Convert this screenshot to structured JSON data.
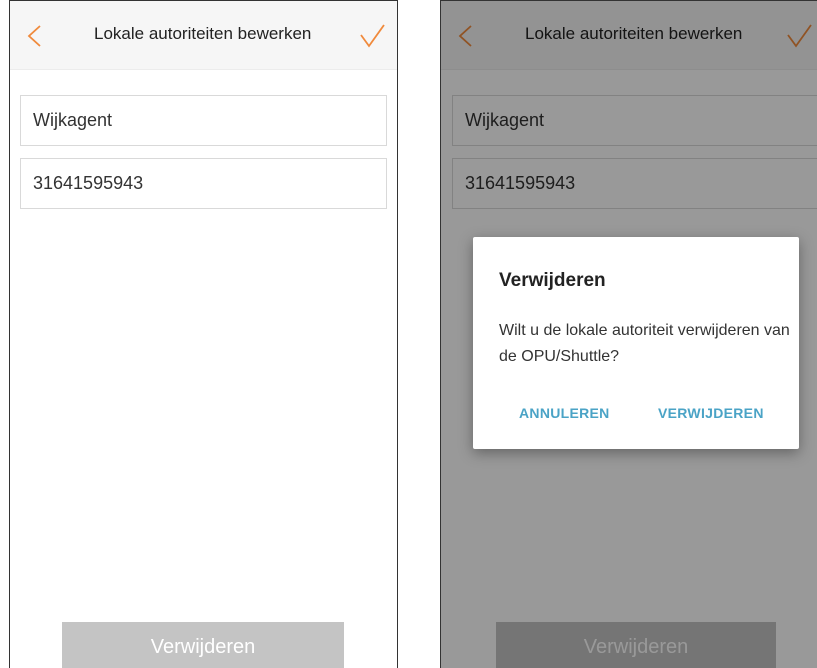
{
  "colors": {
    "accent": "#f08a3c",
    "dialog_button": "#4aa3c6",
    "disabled_button": "#c4c4c4"
  },
  "screens": [
    {
      "header": {
        "title": "Lokale autoriteiten bewerken",
        "back_icon": "chevron-left-icon",
        "confirm_icon": "checkmark-icon"
      },
      "fields": {
        "name_value": "Wijkagent",
        "phone_value": "31641595943"
      },
      "delete_button_label": "Verwijderen"
    },
    {
      "header": {
        "title": "Lokale autoriteiten bewerken",
        "back_icon": "chevron-left-icon",
        "confirm_icon": "checkmark-icon"
      },
      "fields": {
        "name_value": "Wijkagent",
        "phone_value": "31641595943"
      },
      "delete_button_label": "Verwijderen",
      "dialog": {
        "title": "Verwijderen",
        "message": "Wilt u de lokale autoriteit verwijderen van de OPU/Shuttle?",
        "cancel_label": "ANNULEREN",
        "confirm_label": "VERWIJDEREN"
      }
    }
  ]
}
